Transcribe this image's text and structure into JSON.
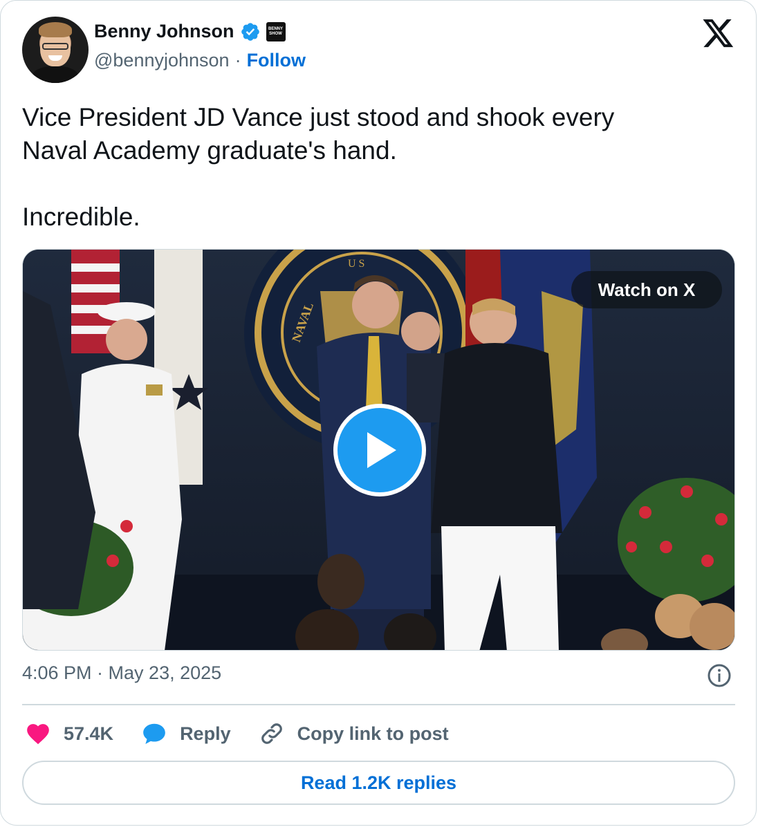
{
  "author": {
    "name": "Benny Johnson",
    "handle": "@bennyjohnson",
    "separator": "·",
    "follow_label": "Follow",
    "affiliate_badge_text": "BENNY SHOW"
  },
  "tweet": {
    "text": "Vice President JD Vance just stood and shook every\nNaval Academy graduate's hand.\n\nIncredible.",
    "timestamp": "4:06 PM · May 23, 2025"
  },
  "media": {
    "watch_label": "Watch on X",
    "seal_text": "NAVAL",
    "seal_text_top": "U S"
  },
  "actions": {
    "likes": "57.4K",
    "reply_label": "Reply",
    "copy_label": "Copy link to post"
  },
  "footer": {
    "read_replies_label": "Read 1.2K replies"
  },
  "colors": {
    "accent": "#006fd6",
    "like": "#f91880",
    "play": "#1d9bf0",
    "muted": "#536471",
    "border": "#cfd9de"
  },
  "icons": [
    "verified-badge-icon",
    "x-logo-icon",
    "play-icon",
    "info-icon",
    "heart-icon",
    "reply-bubble-icon",
    "link-icon"
  ]
}
